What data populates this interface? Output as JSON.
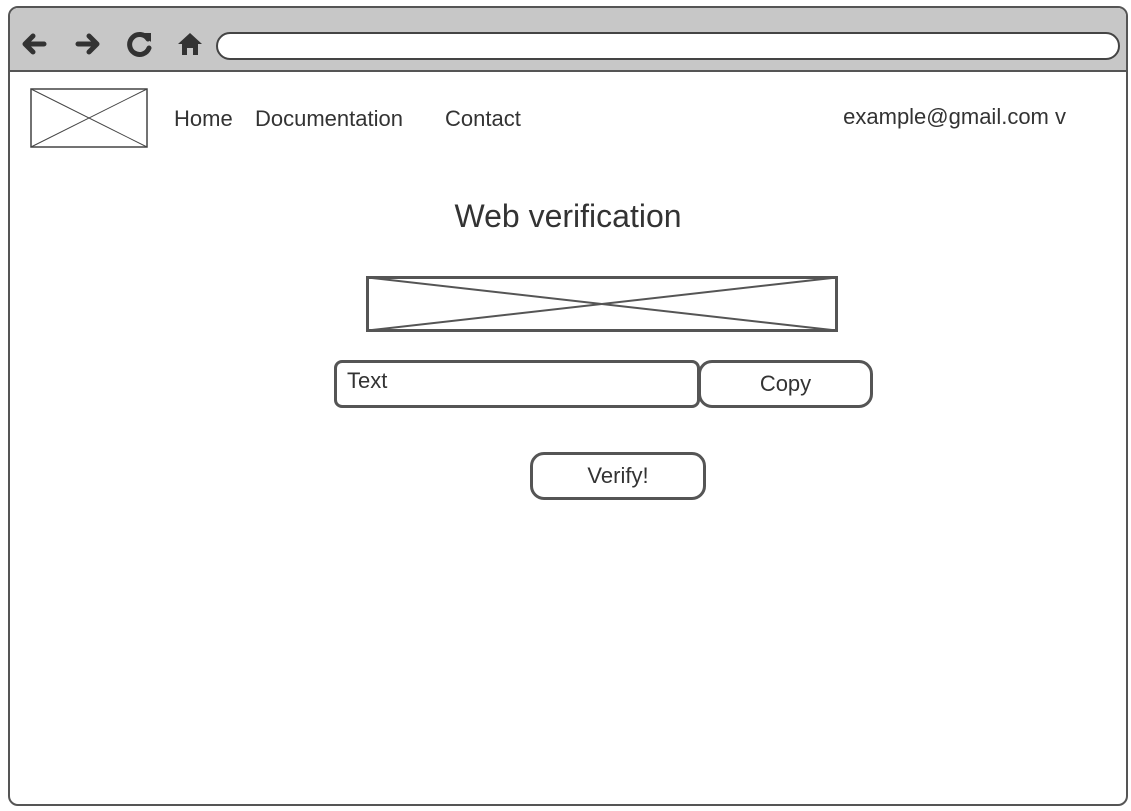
{
  "browser": {
    "back_icon": "arrow-left-icon",
    "forward_icon": "arrow-right-icon",
    "reload_icon": "reload-icon",
    "home_icon": "home-icon",
    "address_value": ""
  },
  "header": {
    "logo": "image-placeholder",
    "nav": [
      {
        "label": "Home"
      },
      {
        "label": "Documentation"
      },
      {
        "label": "Contact"
      }
    ],
    "account_label": "example@gmail.com v"
  },
  "main": {
    "title": "Web verification",
    "image": "image-placeholder",
    "text_field_value": "Text",
    "copy_label": "Copy",
    "verify_label": "Verify!"
  }
}
